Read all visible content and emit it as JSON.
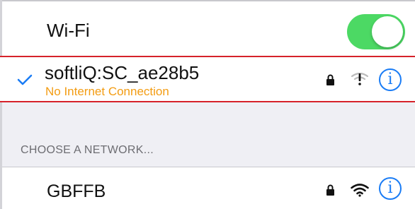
{
  "wifi": {
    "label": "Wi-Fi",
    "enabled": true,
    "toggle_color": "#4cd964"
  },
  "connected_network": {
    "name": "softliQ:SC_ae28b5",
    "status": "No Internet Connection",
    "status_color": "#f39c12",
    "selected": true,
    "icons": [
      "checkmark-icon",
      "lock-icon",
      "wifi-alert-icon",
      "info-icon"
    ],
    "info_glyph": "i"
  },
  "networks_section": {
    "header": "CHOOSE A NETWORK..."
  },
  "networks": [
    {
      "name": "GBFFB",
      "icons": [
        "lock-icon",
        "wifi-icon",
        "info-icon"
      ],
      "info_glyph": "i"
    }
  ],
  "colors": {
    "accent": "#1a7cf5",
    "highlight_border": "#d6222a",
    "group_background": "#efeff4"
  }
}
